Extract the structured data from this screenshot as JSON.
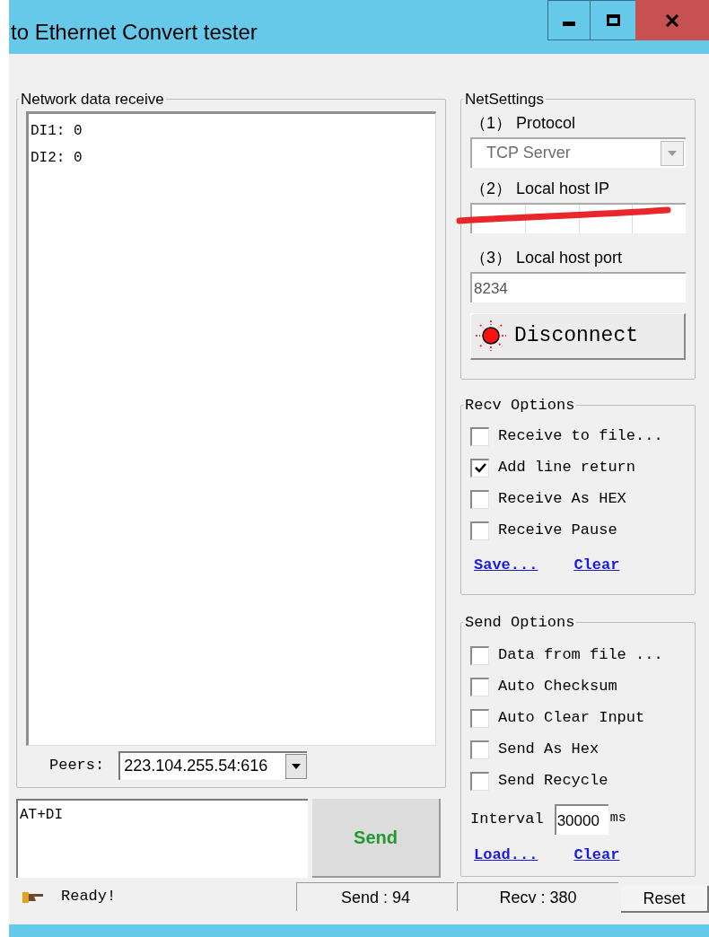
{
  "window": {
    "title": "to Ethernet Convert tester"
  },
  "receive": {
    "title": "Network data receive",
    "lines": [
      "DI1: 0",
      "DI2: 0"
    ],
    "peers_label": "Peers:",
    "peers_value": "223.104.255.54:616"
  },
  "send": {
    "text": "AT+DI",
    "button": "Send"
  },
  "net_settings": {
    "title": "NetSettings",
    "protocol_label": "（1） Protocol",
    "protocol_value": "TCP Server",
    "protocol_disabled": true,
    "ip_label": "（2） Local host IP",
    "port_label": "（3） Local host port",
    "port_value": "8234",
    "connect_button": "Disconnect",
    "connected": true
  },
  "recv_options": {
    "title": "Recv Options",
    "options": [
      {
        "label": "Receive to file...",
        "checked": false
      },
      {
        "label": "Add line return",
        "checked": true
      },
      {
        "label": "Receive As HEX",
        "checked": false
      },
      {
        "label": "Receive Pause",
        "checked": false
      }
    ],
    "links": [
      "Save...",
      "Clear"
    ]
  },
  "send_options": {
    "title": "Send Options",
    "options": [
      {
        "label": "Data from file ...",
        "checked": false
      },
      {
        "label": "Auto Checksum",
        "checked": false
      },
      {
        "label": "Auto Clear Input",
        "checked": false
      },
      {
        "label": "Send As Hex",
        "checked": false
      },
      {
        "label": "Send Recycle",
        "checked": false
      }
    ],
    "interval_label": "Interval",
    "interval_value": "30000",
    "interval_unit": "ms",
    "links": [
      "Load...",
      "Clear"
    ]
  },
  "status": {
    "message": "Ready!",
    "send_count": "Send : 94",
    "recv_count": "Recv : 380",
    "reset": "Reset"
  }
}
